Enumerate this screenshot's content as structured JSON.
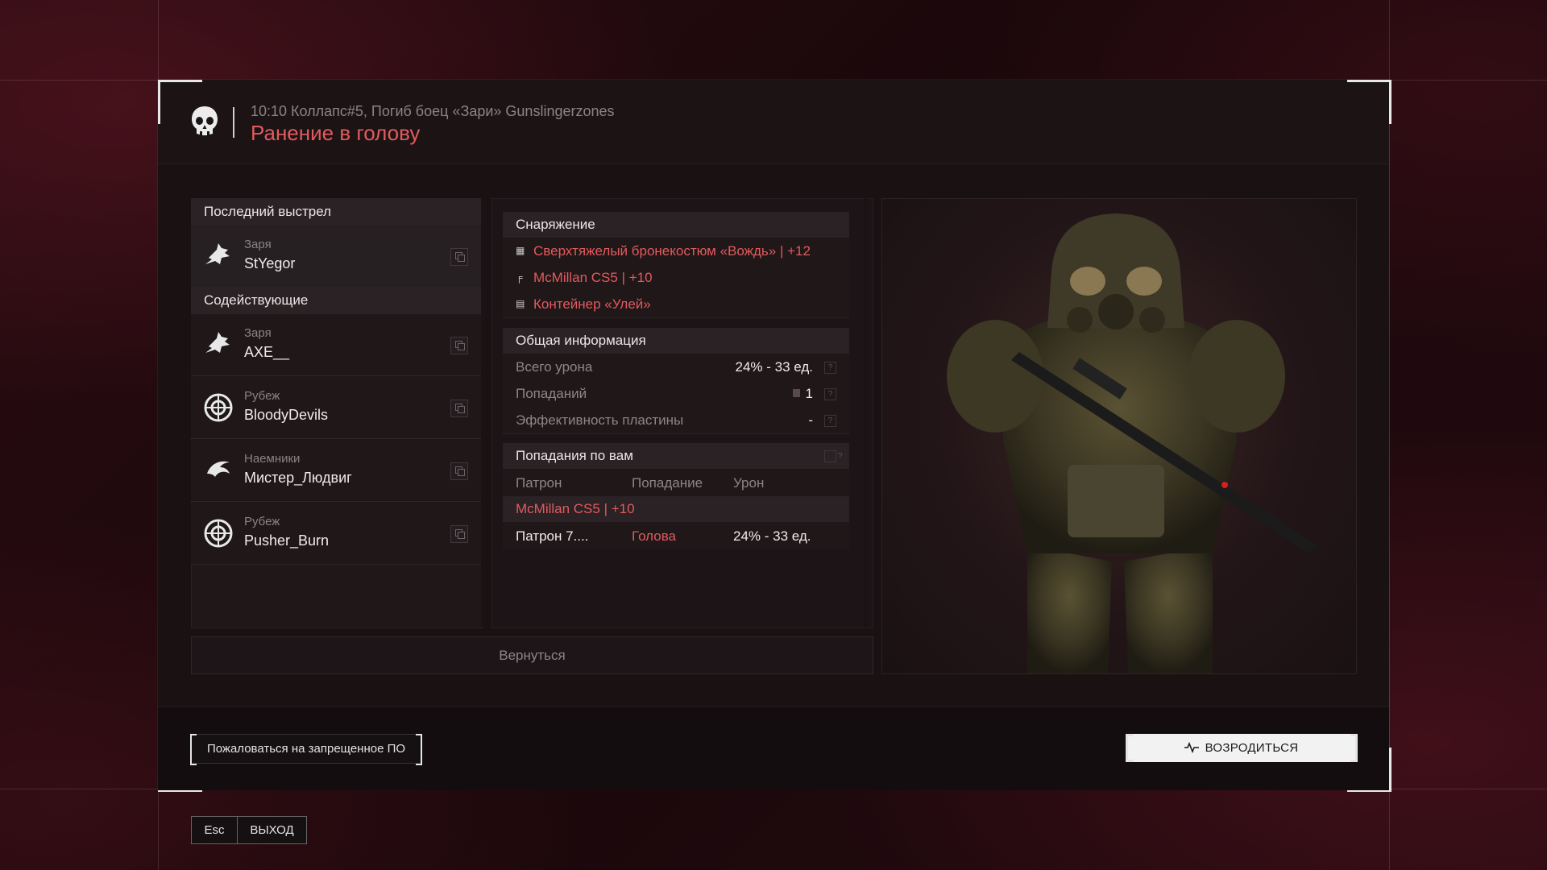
{
  "header": {
    "subtitle": "10:10 Коллапс#5, Погиб боец «Зари» Gunslingerzones",
    "title": "Ранение в голову"
  },
  "last_shot": {
    "header": "Последний выстрел",
    "player": {
      "faction": "Заря",
      "name": "StYegor",
      "icon": "wolf-emblem-icon"
    }
  },
  "assists": {
    "header": "Содействующие",
    "players": [
      {
        "faction": "Заря",
        "name": "AXE__",
        "icon": "wolf-emblem-icon"
      },
      {
        "faction": "Рубеж",
        "name": "BloodyDevils",
        "icon": "shield-emblem-icon"
      },
      {
        "faction": "Наемники",
        "name": "Мистер_Людвиг",
        "icon": "eagle-emblem-icon"
      },
      {
        "faction": "Рубеж",
        "name": "Pusher_Burn",
        "icon": "shield-emblem-icon"
      }
    ]
  },
  "equipment": {
    "header": "Снаряжение",
    "items": [
      {
        "icon": "armor-icon",
        "text": "Сверхтяжелый бронекостюм «Вождь» | +12"
      },
      {
        "icon": "rifle-icon",
        "text": "McMillan CS5 | +10"
      },
      {
        "icon": "container-icon",
        "text": "Контейнер «Улей»"
      }
    ]
  },
  "general_info": {
    "header": "Общая информация",
    "rows": [
      {
        "label": "Всего урона",
        "value": "24% - 33 ед."
      },
      {
        "label": "Попаданий",
        "value": "1"
      },
      {
        "label": "Эффективность пластины",
        "value": "-"
      }
    ]
  },
  "hits_on_you": {
    "header": "Попадания по вам",
    "columns": [
      "Патрон",
      "Попадание",
      "Урон"
    ],
    "weapon": "McMillan CS5 | +10",
    "row": {
      "ammo": "Патрон 7....",
      "hit": "Голова",
      "damage": "24% - 33 ед."
    }
  },
  "buttons": {
    "back": "Вернуться",
    "report": "Пожаловаться на запрещенное ПО",
    "respawn": "ВОЗРОДИТЬСЯ",
    "esc_key": "Esc",
    "exit": "ВЫХОД",
    "help": "?"
  },
  "colors": {
    "accent_red": "#e35a5e",
    "panel": "#1f1718",
    "header_bg": "#2a2224"
  }
}
